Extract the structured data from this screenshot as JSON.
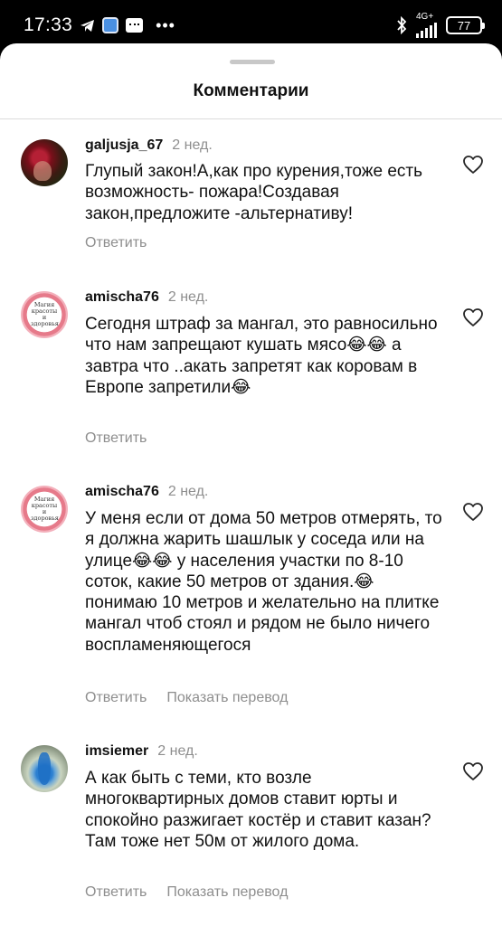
{
  "status_bar": {
    "time": "17:33",
    "network_label": "4G+",
    "battery": "77",
    "icons": [
      "telegram-icon",
      "app-icon",
      "message-icon",
      "more-dots-icon",
      "bluetooth-icon",
      "signal-icon",
      "battery-icon"
    ]
  },
  "sheet": {
    "title": "Комментарии"
  },
  "comments": [
    {
      "username": "galjusja_67",
      "time": "2 нед.",
      "text": "Глупый закон!А,как про курения,тоже есть возможность- пожара!Создавая закон,предложите -альтернативу!",
      "reply_label": "Ответить",
      "avatar": "roses-avatar"
    },
    {
      "username": "amischa76",
      "time": "2 нед.",
      "text": "Сегодня штраф за мангал, это равносильно что нам запрещают кушать мясо😂😂 а завтра что ..акать запретят как коровам в Европе запретили😂",
      "reply_label": "Ответить",
      "avatar": "badge-avatar",
      "avatar_text": "Магия красоты и здоровья"
    },
    {
      "username": "amischa76",
      "time": "2 нед.",
      "text": "У меня если от дома 50 метров отмерять,  то я должна жарить шашлык у соседа или на улице😂😂 у населения участки по 8-10 соток, какие 50 метров от здания.😂 понимаю 10 метров и желательно на плитке мангал чтоб стоял и рядом не было ничего воспламеняющегося",
      "reply_label": "Ответить",
      "translate_label": "Показать перевод",
      "avatar": "badge-avatar",
      "avatar_text": "Магия красоты и здоровья"
    },
    {
      "username": "imsiemer",
      "time": "2 нед.",
      "text": "А как быть с теми, кто возле многоквартирных домов ставит юрты и спокойно разжигает костёр и ставит казан? Там тоже нет 50м от жилого дома.",
      "reply_label": "Ответить",
      "translate_label": "Показать перевод",
      "avatar": "vase-avatar"
    }
  ]
}
